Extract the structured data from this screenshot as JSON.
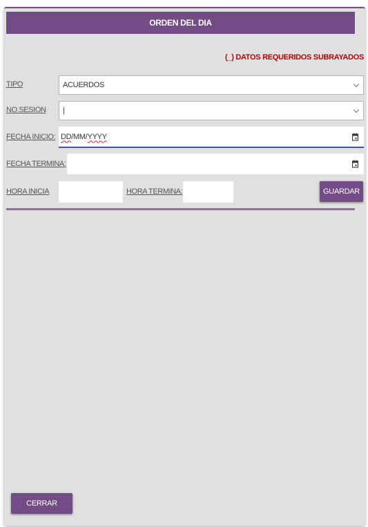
{
  "dialog": {
    "title": "ORDEN DEL DIA",
    "required_note": "(_) DATOS REQUERIDOS SUBRAYADOS"
  },
  "form": {
    "tipo": {
      "label": "TIPO",
      "value": "ACUERDOS"
    },
    "no_sesion": {
      "label": "NO.SESION",
      "value": "|"
    },
    "fecha_inicio": {
      "label": "FECHA INICIO:",
      "placeholder_dd": "DD",
      "placeholder_rest": "/MM/",
      "placeholder_yyyy": "YYYY"
    },
    "fecha_termina": {
      "label": "FECHA TERMINA:",
      "value": ""
    },
    "hora_inicia": {
      "label": "HORA INICIA",
      "value": ""
    },
    "hora_termina": {
      "label": "HORA TERMINA:",
      "value": ""
    }
  },
  "buttons": {
    "guardar": "GUARDAR",
    "cerrar": "CERRAR"
  },
  "icons": {
    "calendar": "calendar-icon",
    "dropdown": "chevron-down-icon"
  },
  "colors": {
    "primary": "#734c86",
    "required": "#c00000",
    "focus": "#3f51b5"
  }
}
